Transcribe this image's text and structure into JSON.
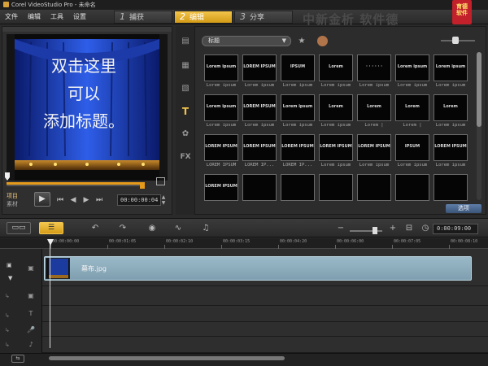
{
  "window": {
    "title": "Corel VideoStudio Pro - 未命名"
  },
  "menu": [
    "文件",
    "编辑",
    "工具",
    "设置"
  ],
  "steps": [
    {
      "num": "1",
      "label": "捕获",
      "active": false
    },
    {
      "num": "2",
      "label": "编辑",
      "active": true
    },
    {
      "num": "3",
      "label": "分享",
      "active": false
    }
  ],
  "watermark": "中新金析 软件德",
  "logo_badge": "育德\n软件",
  "preview": {
    "overlay_text": [
      "双击这里",
      "可以",
      "添加标题。"
    ],
    "mode_project": "项目",
    "mode_clip": "素材",
    "timecode": "00:00:00:04"
  },
  "library": {
    "category_dropdown": "标题",
    "options_label": "选项",
    "thumbnails": [
      {
        "text": "Lorem ipsum",
        "caption": "Lorem ipsum"
      },
      {
        "text": "LOREM IPSUM",
        "caption": "Lorem ipsum"
      },
      {
        "text": "IPSUM",
        "caption": "Lorem ipsum"
      },
      {
        "text": "Lorem",
        "caption": "Lorem ipsum"
      },
      {
        "text": "· · · · · ·",
        "caption": "Lorem ipsum"
      },
      {
        "text": "Lorem ipsum",
        "caption": "Lorem ipsum"
      },
      {
        "text": "Lorem ipsum",
        "caption": "Lorem ipsum"
      },
      {
        "text": "Lorem ipsum",
        "caption": "Lorem ipsum"
      },
      {
        "text": "LOREM IPSUM",
        "caption": "Lorem ipsum"
      },
      {
        "text": "Lorem ipsum",
        "caption": "Lorem ipsum"
      },
      {
        "text": "Lorem",
        "caption": "Lorem ipsum"
      },
      {
        "text": "Lorem",
        "caption": "Lorem |"
      },
      {
        "text": "Lorem",
        "caption": "Lorem |"
      },
      {
        "text": "Lorem",
        "caption": "Lorem ipsum"
      },
      {
        "text": "LOREM IPSUM",
        "caption": "LOREM IPSUM"
      },
      {
        "text": "LOREM IPSUM",
        "caption": "LOREM IP..."
      },
      {
        "text": "LOREM IPSUM",
        "caption": "LOREM IP..."
      },
      {
        "text": "LOREM IPSUM",
        "caption": "Lorem ipsum"
      },
      {
        "text": "LOREM IPSUM",
        "caption": "Lorem ipsum"
      },
      {
        "text": "IPSUM",
        "caption": "Lorem ipsum"
      },
      {
        "text": "LOREM IPSUM",
        "caption": "Lorem ipsum"
      },
      {
        "text": "LOREM IPSUM",
        "caption": ""
      },
      {
        "text": "",
        "caption": ""
      },
      {
        "text": "",
        "caption": ""
      },
      {
        "text": "",
        "caption": ""
      },
      {
        "text": "",
        "caption": ""
      },
      {
        "text": "",
        "caption": ""
      },
      {
        "text": "",
        "caption": ""
      }
    ]
  },
  "timeline": {
    "total_duration": "0:00:09:00",
    "ruler_ticks": [
      "00:00:00:00",
      "00:00:01:05",
      "00:00:02:10",
      "00:00:03:15",
      "00:00:04:20",
      "00:00:06:00",
      "00:00:07:05",
      "00:00:08:10"
    ],
    "clip_name": "幕布.jpg"
  },
  "colors": {
    "accent": "#e2a317",
    "clip": "#8fb0c0"
  }
}
